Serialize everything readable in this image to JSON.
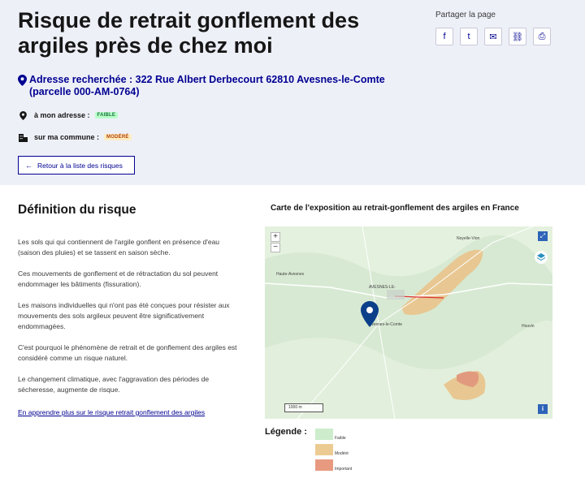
{
  "header": {
    "title": "Risque de retrait gonflement des argiles près de chez moi",
    "share_label": "Partager la page",
    "share_buttons": [
      {
        "icon": "facebook-icon",
        "glyph": "f"
      },
      {
        "icon": "twitter-icon",
        "glyph": "t"
      },
      {
        "icon": "mail-icon",
        "glyph": "✉"
      },
      {
        "icon": "link-icon",
        "glyph": "⛓"
      },
      {
        "icon": "print-icon",
        "glyph": "⎙"
      }
    ],
    "address": "Adresse recherchée : 322 Rue Albert Derbecourt 62810 Avesnes-le-Comte (parcelle 000-AM-0764)",
    "risk_address_label": "à mon adresse :",
    "risk_address_level": "FAIBLE",
    "risk_commune_label": "sur ma commune :",
    "risk_commune_level": "MODÉRÉ",
    "back_button": "Retour à la liste des risques"
  },
  "definition": {
    "title": "Définition du risque",
    "paragraphs": [
      "Les sols qui qui contiennent de l'argile gonflent en présence d'eau (saison des pluies) et se tassent en saison sèche.",
      "Ces mouvements de gonflement et de rétractation du sol peuvent endommager les bâtiments (fissuration).",
      "Les maisons individuelles qui n'ont pas été conçues pour résister aux mouvements des sols argileux peuvent être significativement endommagées.",
      "C'est pourquoi le phénomène de retrait et de gonflement des argiles est considéré comme un risque naturel.",
      "Le changement climatique, avec l'aggravation des périodes de sécheresse, augmente de risque."
    ],
    "learn_more": "En apprendre plus sur le risque retrait gonflement des argiles"
  },
  "map": {
    "title": "Carte de l'exposition au retrait-gonflement des argiles en France",
    "zoom_in": "+",
    "zoom_out": "−",
    "fullscreen": "⤢",
    "info": "i",
    "scale": "1000 m",
    "place_labels": [
      "AVESNES-LE-",
      "Avesnes-le-Comte",
      "Noyelle-Vion",
      "Houvin",
      "Haute-Avesnes"
    ],
    "colors": {
      "low": "#c6e8c2",
      "moderate": "#e9c490",
      "high": "#e29a7e"
    }
  },
  "legend": {
    "title": "Légende :",
    "items": [
      {
        "label": "Faible",
        "color": "#cdeccc"
      },
      {
        "label": "Modéré",
        "color": "#eccb92"
      },
      {
        "label": "Important",
        "color": "#e89a80"
      }
    ]
  }
}
